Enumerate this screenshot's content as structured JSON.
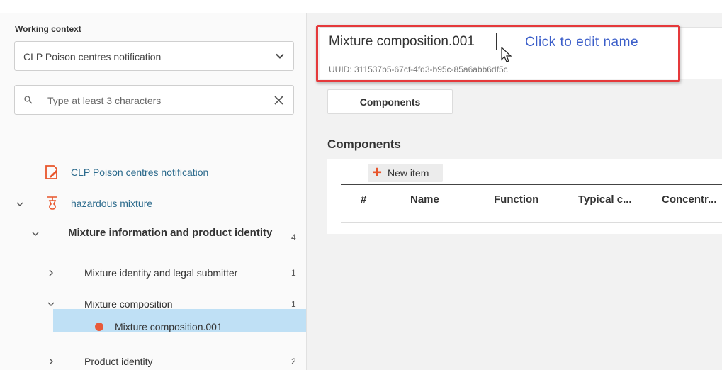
{
  "sidebar": {
    "working_context_label": "Working context",
    "context_select_value": "CLP Poison centres notification",
    "search_placeholder": "Type at least 3 characters",
    "tree": [
      {
        "label": "CLP Poison centres notification",
        "icon": "edit-document-icon"
      },
      {
        "label": "hazardous mixture",
        "icon": "flask-icon"
      },
      {
        "label": "Mixture information and product identity",
        "count": "4"
      },
      {
        "label": "Mixture identity and legal submitter",
        "count": "1"
      },
      {
        "label": "Mixture composition",
        "count": "1"
      },
      {
        "label": "Mixture composition.001",
        "icon": "status-dot-icon"
      },
      {
        "label": "Product identity",
        "count": "2"
      }
    ]
  },
  "main": {
    "name": "Mixture composition.001",
    "uuid": "UUID: 311537b5-67cf-4fd3-b95c-85a6abb6df5c",
    "hint": "Click to edit name",
    "tab_components": "Components",
    "section_title": "Components",
    "new_item_label": "New item",
    "columns": [
      "#",
      "Name",
      "Function",
      "Typical c...",
      "Concentr..."
    ]
  },
  "colors": {
    "accent_link": "#2b6a8c",
    "selected_row": "#bfe0f5",
    "highlight_border": "#e5393b",
    "hint_text": "#3b5ec9",
    "add_icon": "#e8552b",
    "status_dot": "#e85a3a"
  }
}
